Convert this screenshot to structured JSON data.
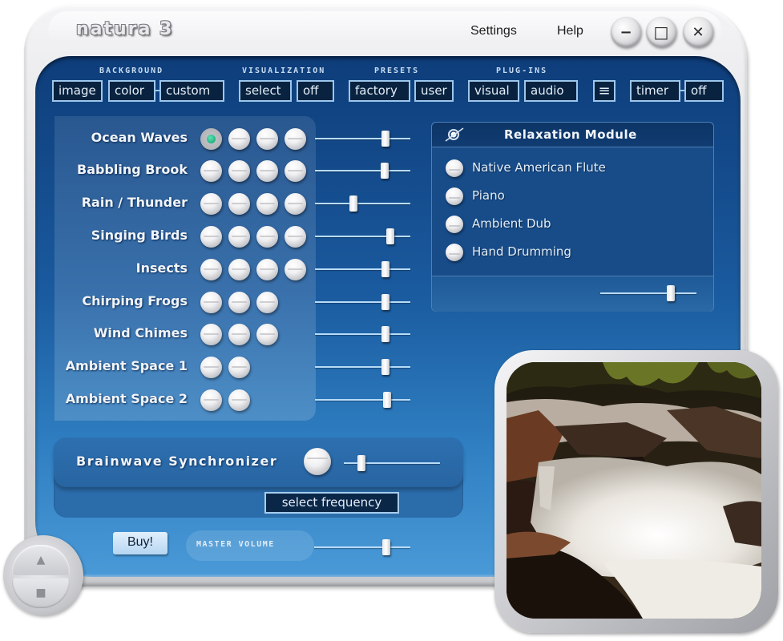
{
  "window": {
    "title": "natura 3",
    "menu": [
      {
        "label": "Settings"
      },
      {
        "label": "Help"
      }
    ],
    "controls": {
      "minimize_icon": "−",
      "maximize_icon": "□",
      "close_icon": "✕"
    }
  },
  "toolbar": {
    "groups": [
      {
        "label": "BACKGROUND",
        "buttons": [
          "image",
          "color",
          "custom"
        ]
      },
      {
        "label": "VISUALIZATION",
        "buttons": [
          "select",
          "off"
        ]
      },
      {
        "label": "PRESETS",
        "buttons": [
          "factory",
          "user"
        ]
      },
      {
        "label": "PLUG-INS",
        "buttons": [
          "visual",
          "audio"
        ]
      }
    ],
    "list_icon": "≡",
    "timer": {
      "label": "timer",
      "value": "off"
    }
  },
  "sounds": [
    {
      "name": "Ocean Waves",
      "variants": 4,
      "active_variant": 1,
      "volume_pct": 74
    },
    {
      "name": "Babbling Brook",
      "variants": 4,
      "active_variant": null,
      "volume_pct": 73
    },
    {
      "name": "Rain / Thunder",
      "variants": 4,
      "active_variant": null,
      "volume_pct": 40
    },
    {
      "name": "Singing Birds",
      "variants": 4,
      "active_variant": null,
      "volume_pct": 79
    },
    {
      "name": "Insects",
      "variants": 4,
      "active_variant": null,
      "volume_pct": 74
    },
    {
      "name": "Chirping Frogs",
      "variants": 3,
      "active_variant": null,
      "volume_pct": 74
    },
    {
      "name": "Wind Chimes",
      "variants": 3,
      "active_variant": null,
      "volume_pct": 74
    },
    {
      "name": "Ambient Space 1",
      "variants": 2,
      "active_variant": null,
      "volume_pct": 74
    },
    {
      "name": "Ambient Space 2",
      "variants": 2,
      "active_variant": null,
      "volume_pct": 76
    }
  ],
  "relaxation_module": {
    "title": "Relaxation Module",
    "items": [
      {
        "label": "Native American Flute"
      },
      {
        "label": "Piano"
      },
      {
        "label": "Ambient Dub"
      },
      {
        "label": "Hand Drumming"
      }
    ],
    "volume_pct": 73
  },
  "brainwave": {
    "title": "Brainwave Synchronizer",
    "level_pct": 18,
    "select_frequency_label": "select frequency"
  },
  "bottom": {
    "buy_label": "Buy!",
    "master_volume_label": "MASTER VOLUME",
    "master_volume_pct": 75,
    "transport": {
      "up_icon": "▲",
      "stop_icon": "■"
    }
  },
  "scene": {
    "description": "Waterfall over rocks in a forest stream"
  },
  "colors": {
    "panel_dark": "#0e3d7a",
    "panel_light": "#4a9ad8",
    "button_border": "#9cc7ec",
    "button_fill": "#08223f",
    "active_indicator": "#0a9e6a"
  }
}
